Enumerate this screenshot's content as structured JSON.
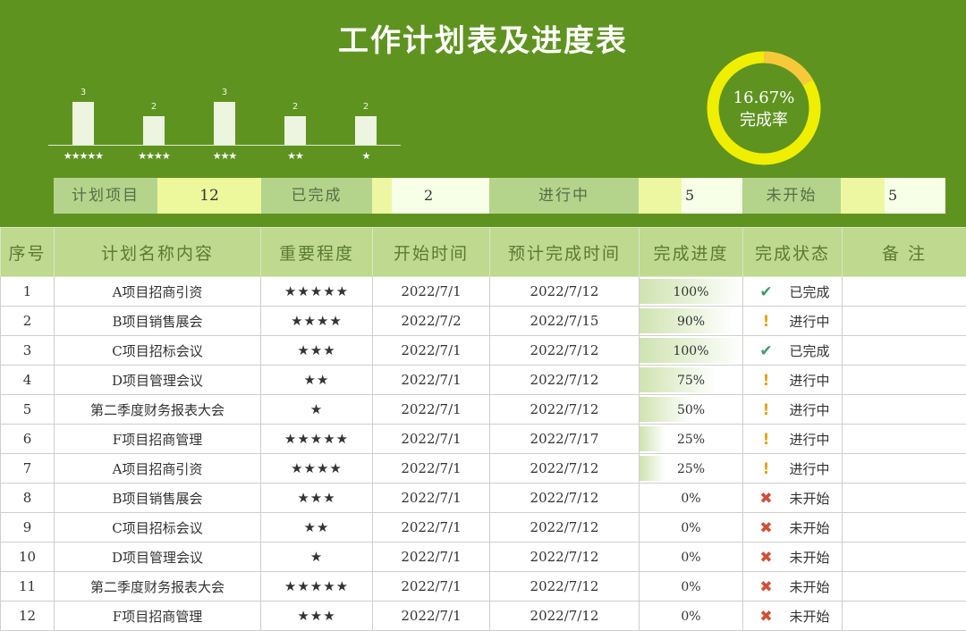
{
  "title": "工作计划表及进度表",
  "chart_data": {
    "type": "bar",
    "categories": [
      "★★★★★",
      "★★★★",
      "★★★",
      "★★",
      "★"
    ],
    "values": [
      3,
      2,
      3,
      2,
      2
    ],
    "title": "",
    "xlabel": "",
    "ylabel": "",
    "ylim": [
      0,
      3
    ],
    "grid": false
  },
  "completion": {
    "percent_text": "16.67%",
    "label": "完成率",
    "value": 0.1667,
    "ring_color": "#f0ef00",
    "fill_color": "#f5c93a"
  },
  "summary": {
    "planned_label": "计划项目",
    "planned_value": "12",
    "done_label": "已完成",
    "done_value": "2",
    "done_fraction": 0.1667,
    "inprogress_label": "进行中",
    "inprogress_value": "5",
    "inprogress_fraction": 0.4167,
    "notstarted_label": "未开始",
    "notstarted_value": "5",
    "notstarted_fraction": 0.4167
  },
  "table": {
    "headers": [
      "序号",
      "计划名称内容",
      "重要程度",
      "开始时间",
      "预计完成时间",
      "完成进度",
      "完成状态",
      "备 注"
    ],
    "rows": [
      {
        "no": "1",
        "name": "A项目招商引资",
        "stars": "★★★★★",
        "start": "2022/7/1",
        "end": "2022/7/12",
        "progress": "100%",
        "progress_value": 1.0,
        "status": "已完成",
        "status_icon": "check-icon",
        "note": ""
      },
      {
        "no": "2",
        "name": "B项目销售展会",
        "stars": "★★★★",
        "start": "2022/7/2",
        "end": "2022/7/15",
        "progress": "90%",
        "progress_value": 0.9,
        "status": "进行中",
        "status_icon": "exclamation-icon",
        "note": ""
      },
      {
        "no": "3",
        "name": "C项目招标会议",
        "stars": "★★★",
        "start": "2022/7/1",
        "end": "2022/7/12",
        "progress": "100%",
        "progress_value": 1.0,
        "status": "已完成",
        "status_icon": "check-icon",
        "note": ""
      },
      {
        "no": "4",
        "name": "D项目管理会议",
        "stars": "★★",
        "start": "2022/7/1",
        "end": "2022/7/12",
        "progress": "75%",
        "progress_value": 0.75,
        "status": "进行中",
        "status_icon": "exclamation-icon",
        "note": ""
      },
      {
        "no": "5",
        "name": "第二季度财务报表大会",
        "stars": "★",
        "start": "2022/7/1",
        "end": "2022/7/12",
        "progress": "50%",
        "progress_value": 0.5,
        "status": "进行中",
        "status_icon": "exclamation-icon",
        "note": ""
      },
      {
        "no": "6",
        "name": "F项目招商管理",
        "stars": "★★★★★",
        "start": "2022/7/1",
        "end": "2022/7/17",
        "progress": "25%",
        "progress_value": 0.25,
        "status": "进行中",
        "status_icon": "exclamation-icon",
        "note": ""
      },
      {
        "no": "7",
        "name": "A项目招商引资",
        "stars": "★★★★",
        "start": "2022/7/1",
        "end": "2022/7/12",
        "progress": "25%",
        "progress_value": 0.25,
        "status": "进行中",
        "status_icon": "exclamation-icon",
        "note": ""
      },
      {
        "no": "8",
        "name": "B项目销售展会",
        "stars": "★★★",
        "start": "2022/7/1",
        "end": "2022/7/12",
        "progress": "0%",
        "progress_value": 0,
        "status": "未开始",
        "status_icon": "cross-icon",
        "note": ""
      },
      {
        "no": "9",
        "name": "C项目招标会议",
        "stars": "★★",
        "start": "2022/7/1",
        "end": "2022/7/12",
        "progress": "0%",
        "progress_value": 0,
        "status": "未开始",
        "status_icon": "cross-icon",
        "note": ""
      },
      {
        "no": "10",
        "name": "D项目管理会议",
        "stars": "★",
        "start": "2022/7/1",
        "end": "2022/7/12",
        "progress": "0%",
        "progress_value": 0,
        "status": "未开始",
        "status_icon": "cross-icon",
        "note": ""
      },
      {
        "no": "11",
        "name": "第二季度财务报表大会",
        "stars": "★★★★★",
        "start": "2022/7/1",
        "end": "2022/7/12",
        "progress": "0%",
        "progress_value": 0,
        "status": "未开始",
        "status_icon": "cross-icon",
        "note": ""
      },
      {
        "no": "12",
        "name": "F项目招商管理",
        "stars": "★★★",
        "start": "2022/7/1",
        "end": "2022/7/12",
        "progress": "0%",
        "progress_value": 0,
        "status": "未开始",
        "status_icon": "cross-icon",
        "note": ""
      }
    ]
  },
  "colors": {
    "header_bg": "#5f9320",
    "table_header_bg": "#bfd98e",
    "star": "#d98470"
  }
}
